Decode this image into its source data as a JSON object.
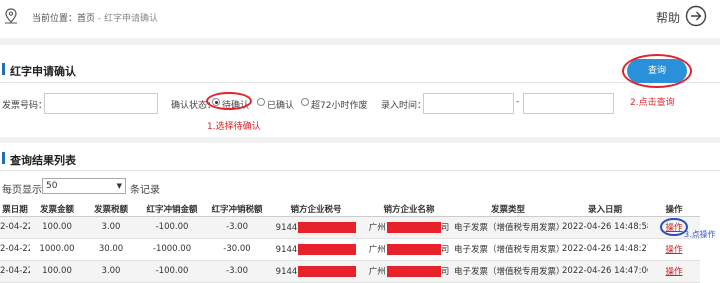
{
  "breadcrumb": {
    "prefix": "当前位置：",
    "home": "首页",
    "sep": " - ",
    "current": "红字申请确认"
  },
  "help": {
    "label": "帮助"
  },
  "apply_section": {
    "title": "红字申请确认",
    "query_button": "查询"
  },
  "filters": {
    "invoice_no_label": "发票号码：",
    "invoice_no_value": "",
    "confirm_status_label": "确认状态：",
    "status_options": [
      {
        "label": "待确认",
        "checked": true
      },
      {
        "label": "已确认",
        "checked": false
      },
      {
        "label": "超72小时作废",
        "checked": false
      }
    ],
    "entry_time_label": "录入时间：",
    "entry_time_from": "",
    "range_sep": "-",
    "entry_time_to": ""
  },
  "annotations": {
    "step1": "1.选择待确认",
    "step2": "2.点击查询",
    "step3": "3.点操作"
  },
  "results_section": {
    "title": "查询结果列表"
  },
  "pagination": {
    "prefix": "每页显示",
    "page_size": "50",
    "suffix": "条记录"
  },
  "table": {
    "headers": [
      "票日期",
      "发票金额",
      "发票税额",
      "红字冲销金额",
      "红字冲销税额",
      "销方企业税号",
      "销方企业名称",
      "发票类型",
      "录入日期",
      "操作"
    ],
    "rows": [
      {
        "date": "2-04-22",
        "amount": "100.00",
        "tax": "3.00",
        "red_amount": "-100.00",
        "red_tax": "-3.00",
        "seller_tax_id": "9144",
        "seller_name_pre": "广州",
        "seller_name_post": "司",
        "type": "电子发票（增值税专用发票）",
        "entry_date": "2022-04-26 14:48:58",
        "op": "操作"
      },
      {
        "date": "2-04-22",
        "amount": "1000.00",
        "tax": "30.00",
        "red_amount": "-1000.00",
        "red_tax": "-30.00",
        "seller_tax_id": "9144",
        "seller_name_pre": "广州",
        "seller_name_post": "司",
        "type": "电子发票（增值税专用发票）",
        "entry_date": "2022-04-26 14:48:27",
        "op": "操作"
      },
      {
        "date": "2-04-22",
        "amount": "100.00",
        "tax": "3.00",
        "red_amount": "-100.00",
        "red_tax": "-3.00",
        "seller_tax_id": "9144",
        "seller_name_pre": "广州",
        "seller_name_post": "司",
        "type": "电子发票（增值税专用发票）",
        "entry_date": "2022-04-26 14:47:06",
        "op": "操作"
      }
    ]
  },
  "colors": {
    "accent_blue": "#2a90d9",
    "annotation_red": "#e0242a",
    "annotation_blue": "#3554c4",
    "redaction": "#e8222a"
  }
}
